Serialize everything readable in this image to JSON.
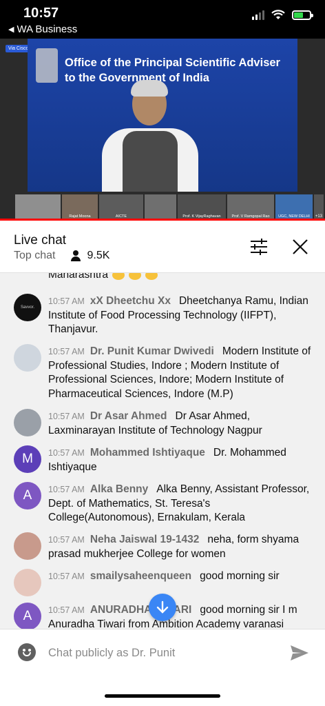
{
  "status_bar": {
    "time": "10:57",
    "back_app": "WA Business",
    "battery_level": 0.6
  },
  "video": {
    "watermark": "Via CiscoWebex",
    "title_line1": "Office of the Principal Scientific Adviser",
    "title_line2": "to the Government of India",
    "thumbnails": [
      {
        "label": ""
      },
      {
        "label": "Rajat Moona"
      },
      {
        "label": "AICTE"
      },
      {
        "label": ""
      },
      {
        "label": "Prof. K VijayRaghavan"
      },
      {
        "label": "Prof. V Ramgopal Rao"
      },
      {
        "label": "UGC, NEW DELHI"
      },
      {
        "label": ""
      }
    ],
    "more_count": "+13",
    "progress": 1.0
  },
  "chat": {
    "title": "Live chat",
    "mode": "Top chat",
    "viewer_count": "9.5K",
    "partial_text": "Maharashtra",
    "messages": [
      {
        "avatar_letter": "",
        "avatar_text": "Savvor.",
        "time": "10:57 AM",
        "author": "xX Dheetchu Xx",
        "text": "Dheetchanya Ramu, Indian Institute of Food Processing Technology (IIFPT), Thanjavur."
      },
      {
        "avatar_letter": "",
        "time": "10:57 AM",
        "author": "Dr. Punit Kumar Dwivedi",
        "text": "Modern Institute of Professional Studies, Indore ; Modern Institute of Professional Sciences, Indore; Modern Institute of Pharmaceutical Sciences, Indore (M.P)"
      },
      {
        "avatar_letter": "",
        "time": "10:57 AM",
        "author": "Dr Asar Ahmed",
        "text": "Dr Asar Ahmed, Laxminarayan Institute of Technology Nagpur"
      },
      {
        "avatar_letter": "M",
        "time": "10:57 AM",
        "author": "Mohammed Ishtiyaque",
        "text": "Dr. Mohammed Ishtiyaque"
      },
      {
        "avatar_letter": "A",
        "time": "10:57 AM",
        "author": "Alka Benny",
        "text": "Alka Benny, Assistant Professor, Dept. of Mathematics, St. Teresa's College(Autonomous), Ernakulam, Kerala"
      },
      {
        "avatar_letter": "",
        "time": "10:57 AM",
        "author": "Neha Jaiswal 19-1432",
        "text": "neha, form shyama prasad mukherjee College for women"
      },
      {
        "avatar_letter": "",
        "time": "10:57 AM",
        "author": "smailysaheenqueen",
        "text": "good morning sir"
      },
      {
        "avatar_letter": "A",
        "time": "10:57 AM",
        "author": "ANURADHA TIWARI",
        "text": "good morning sir I m Anuradha Tiwari from Ambition Academy varanasi"
      }
    ],
    "input_placeholder": "Chat publicly as Dr. Punit"
  }
}
